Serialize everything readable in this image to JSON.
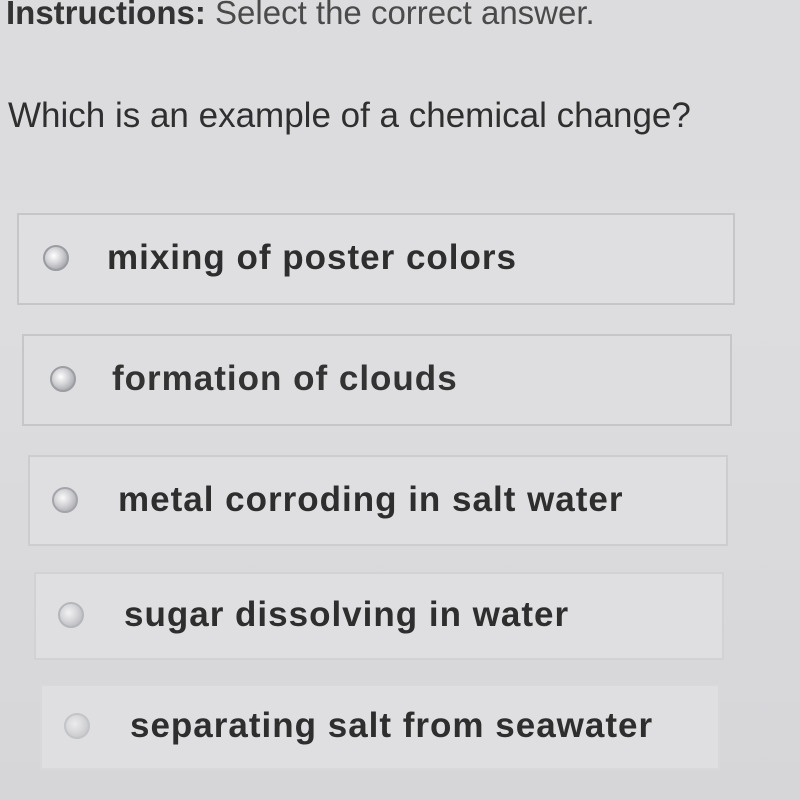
{
  "instructions": {
    "label": "Instructions:",
    "text": "Select the correct answer."
  },
  "question": {
    "text": "Which is an example of a chemical change?"
  },
  "options": [
    {
      "label": "mixing of poster colors",
      "selected": false
    },
    {
      "label": "formation of clouds",
      "selected": false
    },
    {
      "label": "metal corroding in salt water",
      "selected": false
    },
    {
      "label": "sugar dissolving in water",
      "selected": false
    },
    {
      "label": "separating salt from seawater",
      "selected": false
    }
  ]
}
